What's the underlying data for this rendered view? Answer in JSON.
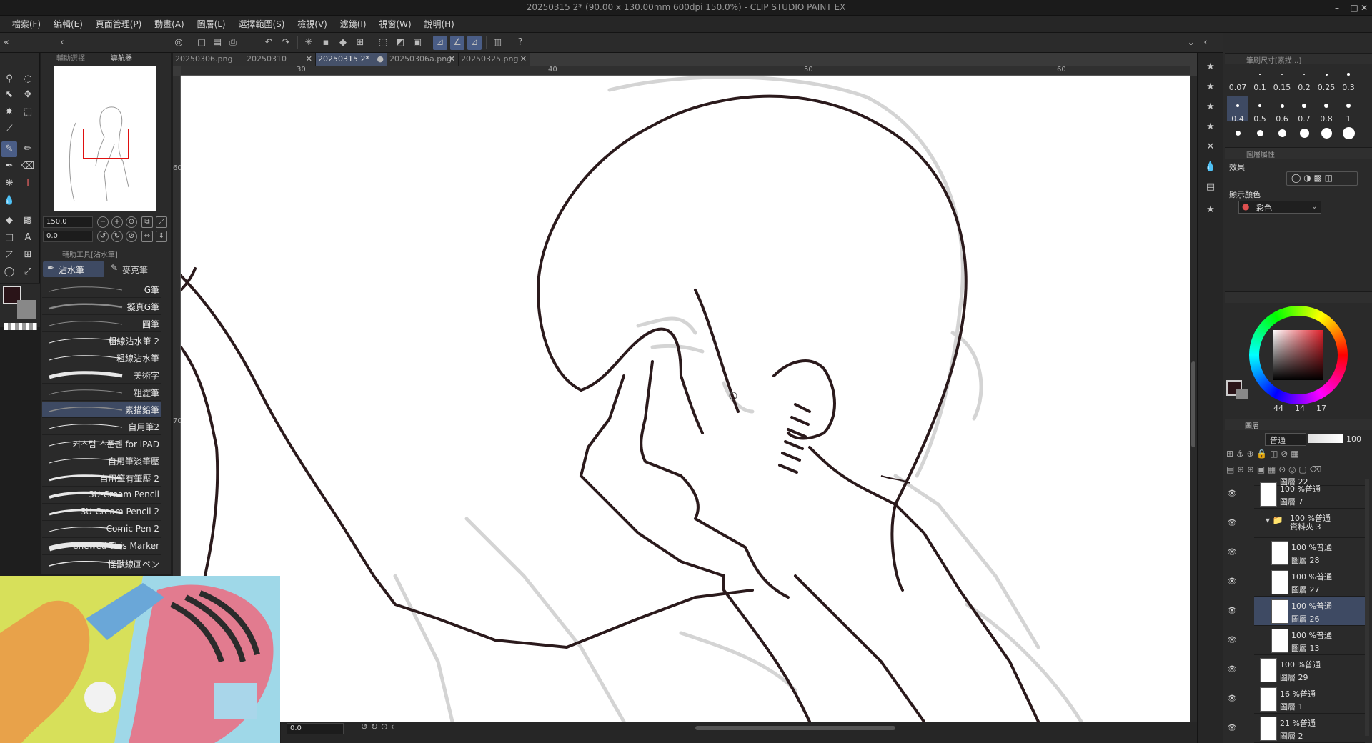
{
  "window": {
    "title": "20250315 2* (90.00 x 130.00mm 600dpi 150.0%) - CLIP STUDIO PAINT EX",
    "controls": [
      "–",
      "□",
      "✕"
    ]
  },
  "menu": [
    "檔案(F)",
    "編輯(E)",
    "頁面管理(P)",
    "動畫(A)",
    "圖層(L)",
    "選擇範圍(S)",
    "檢視(V)",
    "濾鏡(I)",
    "視窗(W)",
    "說明(H)"
  ],
  "nav_panel": {
    "tabs": [
      "輔助選擇",
      "導航器"
    ],
    "zoom": "150.0",
    "rotation": "0.0"
  },
  "subtool": {
    "header": "輔助工具[沾水筆]",
    "tabs": [
      "沾水筆",
      "麥克筆"
    ],
    "brushes": [
      "G筆",
      "擬真G筆",
      "圓筆",
      "粗線沾水筆 2",
      "粗線沾水筆",
      "美術字",
      "粗澀筆",
      "素描鉛筆",
      "自用筆2",
      "커스텀 스푼펜 for iPAD",
      "自用筆淡筆壓",
      "自用筆有筆壓 2",
      "SU-Cream Pencil",
      "SU-Cream Pencil 2",
      "Comic Pen 2",
      "Chewed This Marker",
      "怪獸線画ペン"
    ],
    "selected_index": 7
  },
  "documents": {
    "tabs": [
      "20250306.png",
      "20250310",
      "20250315 2*",
      "20250306a.png",
      "20250325.png"
    ],
    "active_index": 2
  },
  "ruler": {
    "h": [
      "30",
      "40",
      "50",
      "60"
    ],
    "v": [
      "60",
      "70"
    ]
  },
  "statusbar": {
    "zoom": "0.0"
  },
  "brush_size": {
    "header": "筆刷尺寸[素描...]",
    "sizes": [
      "0.07",
      "0.1",
      "0.15",
      "0.2",
      "0.25",
      "0.3",
      "0.4",
      "0.5",
      "0.6",
      "0.7",
      "0.8",
      "1"
    ],
    "selected": "0.4"
  },
  "layer_property": {
    "header": "圖層屬性",
    "effect_label": "效果",
    "display_color_label": "顯示顏色",
    "display_color_value": "彩色"
  },
  "color": {
    "values": [
      "44",
      "14",
      "17"
    ],
    "current": "#2a1418"
  },
  "layers": {
    "tabs": [
      "圖層"
    ],
    "blend_mode": "普通",
    "opacity": "100",
    "items": [
      {
        "pct": "",
        "mode": "圖層 22",
        "name": ""
      },
      {
        "pct": "100 %",
        "mode": "普通",
        "name": "圖層 7"
      },
      {
        "pct": "100 %",
        "mode": "普通",
        "name": "資料夾 3"
      },
      {
        "pct": "100 %",
        "mode": "普通",
        "name": "圖層 28"
      },
      {
        "pct": "100 %",
        "mode": "普通",
        "name": "圖層 27"
      },
      {
        "pct": "100 %",
        "mode": "普通",
        "name": "圖層 26"
      },
      {
        "pct": "100 %",
        "mode": "普通",
        "name": "圖層 13"
      },
      {
        "pct": "100 %",
        "mode": "普通",
        "name": "圖層 29"
      },
      {
        "pct": "16 %",
        "mode": "普通",
        "name": "圖層 1"
      },
      {
        "pct": "21 %",
        "mode": "普通",
        "name": "圖層 2"
      }
    ],
    "selected_index": 5
  },
  "icons": {
    "eye": "eye-icon",
    "folder": "folder-icon",
    "pen": "pen-icon"
  },
  "accent": "#4a5d86"
}
